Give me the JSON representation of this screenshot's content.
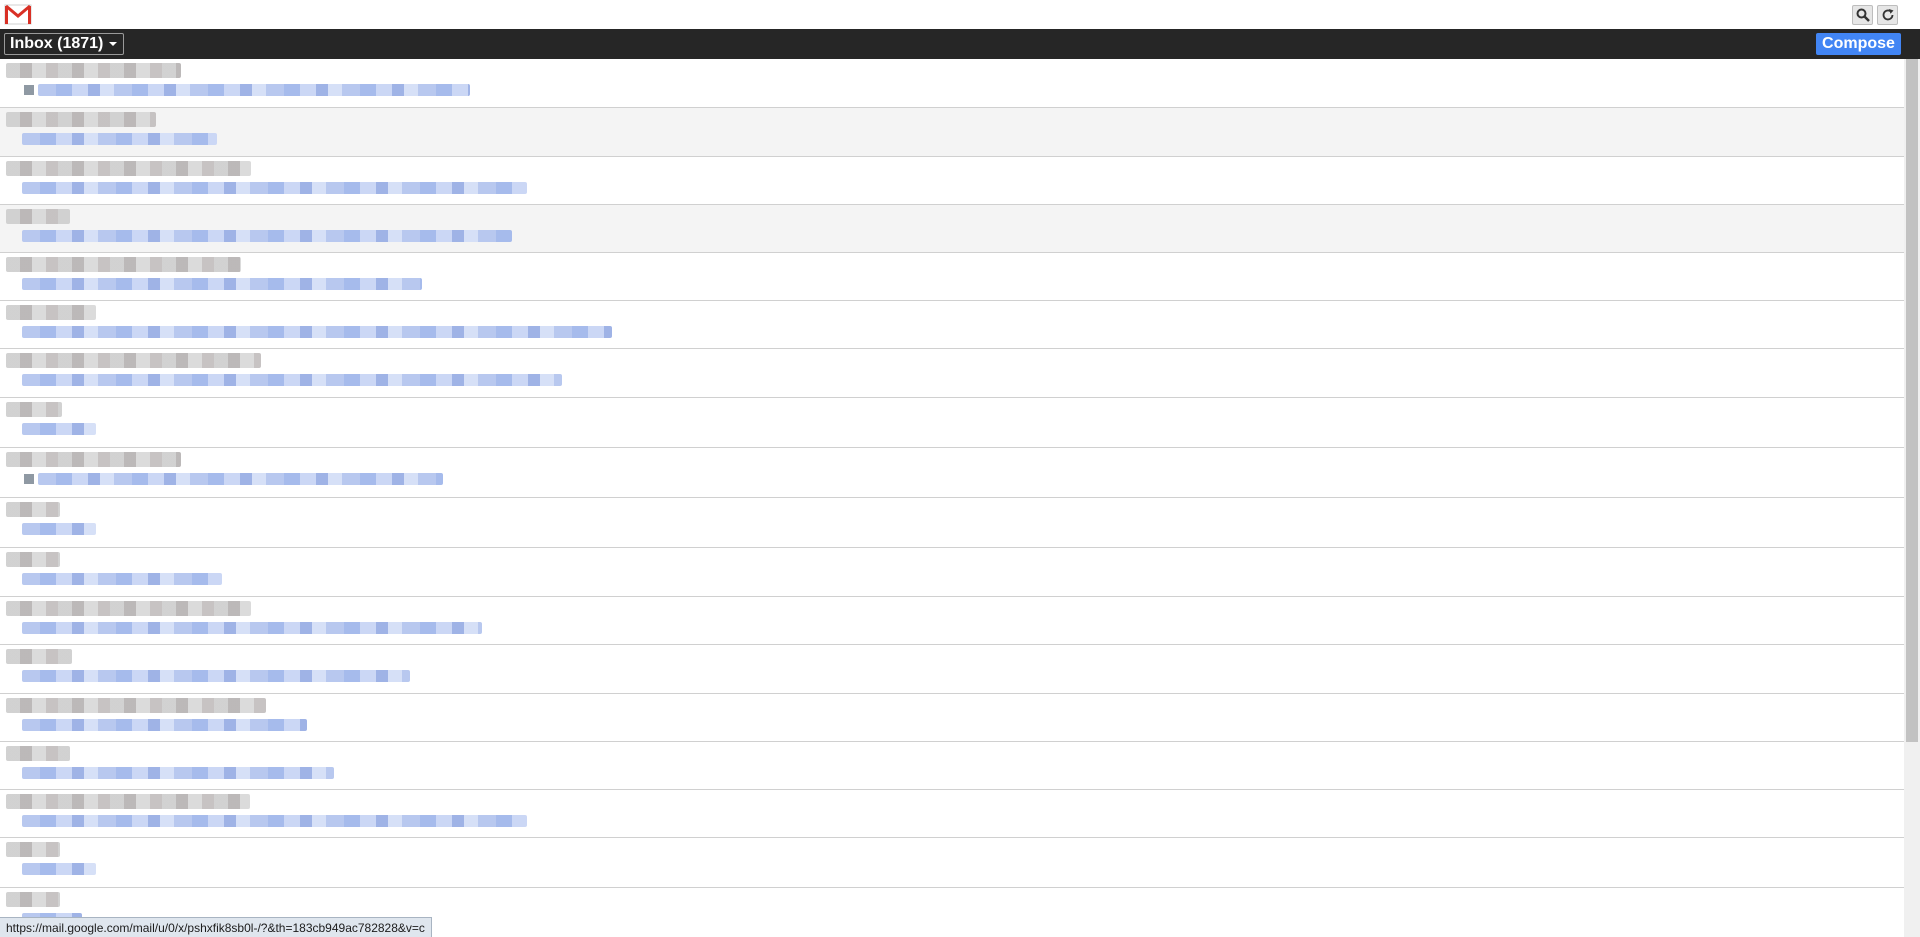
{
  "header": {
    "inbox_label": "Inbox (1871)",
    "compose_label": "Compose"
  },
  "toolbar": {
    "search_icon": "search-icon",
    "refresh_icon": "refresh-icon"
  },
  "colors": {
    "header_bg": "#262626",
    "compose_bg": "#4285f4",
    "logo_red": "#d93025"
  },
  "status_bar": {
    "url": "https://mail.google.com/mail/u/0/x/pshxfik8sb0l-/?&th=183cb949ac782828&v=c"
  }
}
